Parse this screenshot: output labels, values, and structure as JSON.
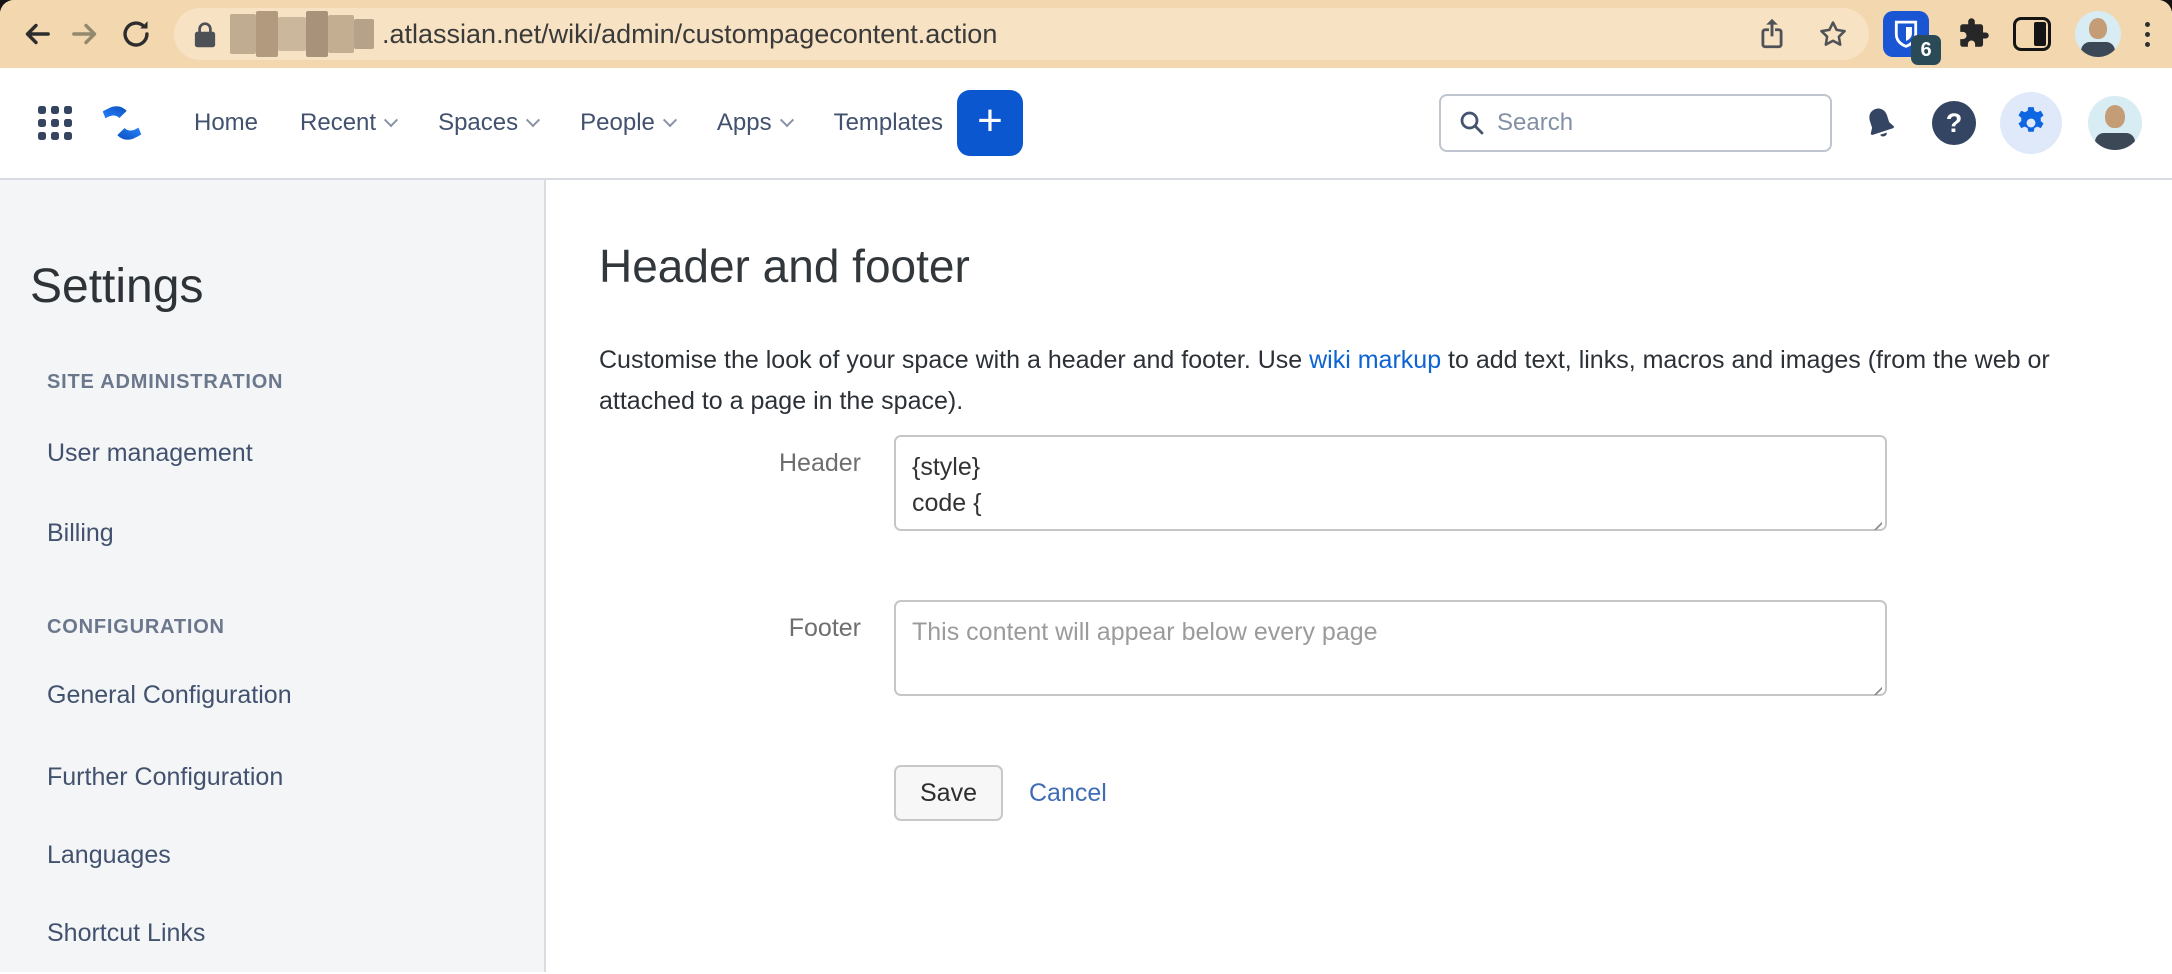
{
  "browser": {
    "url_visible": ".atlassian.net/wiki/admin/custompagecontent.action",
    "extension_badge": "6"
  },
  "navbar": {
    "items": [
      {
        "label": "Home"
      },
      {
        "label": "Recent"
      },
      {
        "label": "Spaces"
      },
      {
        "label": "People"
      },
      {
        "label": "Apps"
      },
      {
        "label": "Templates"
      }
    ],
    "create_label": "+",
    "search_placeholder": "Search",
    "help_glyph": "?"
  },
  "sidebar": {
    "title": "Settings",
    "sections": [
      {
        "header": "SITE ADMINISTRATION",
        "items": [
          "User management",
          "Billing"
        ]
      },
      {
        "header": "CONFIGURATION",
        "items": [
          "General Configuration",
          "Further Configuration",
          "Languages",
          "Shortcut Links"
        ]
      }
    ]
  },
  "main": {
    "title": "Header and footer",
    "description_before_link": "Customise the look of your space with a header and footer. Use ",
    "description_link": "wiki markup",
    "description_after_link": " to add text, links, macros and images (from the web or attached to a page in the space).",
    "header_label": "Header",
    "header_value": "{style}\ncode {",
    "footer_label": "Footer",
    "footer_placeholder": "This content will appear below every page",
    "save_label": "Save",
    "cancel_label": "Cancel"
  },
  "colors": {
    "chrome_bar": "#f3d7ae",
    "omnibox": "#f7e2c3",
    "accent_blue": "#0b57cf",
    "nav_text": "#42526e",
    "link_blue": "#0c63d4",
    "cancel_blue": "#3f6db4",
    "sidebar_bg": "#f4f5f7",
    "section_header": "#6b778c"
  }
}
